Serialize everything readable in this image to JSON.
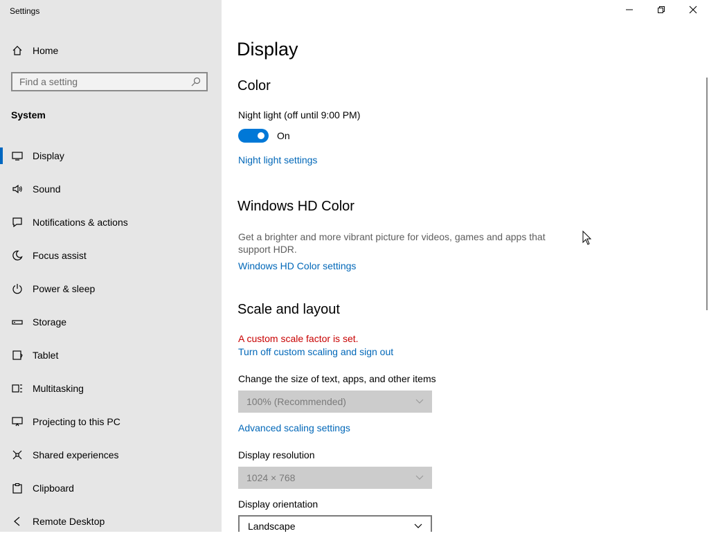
{
  "app": {
    "title": "Settings"
  },
  "window_controls": {
    "minimize": "minimize-icon",
    "restore": "restore-icon",
    "close": "close-icon"
  },
  "sidebar": {
    "home_label": "Home",
    "search_placeholder": "Find a setting",
    "section_label": "System",
    "items": [
      {
        "label": "Display",
        "icon": "monitor-icon",
        "selected": true
      },
      {
        "label": "Sound",
        "icon": "speaker-icon"
      },
      {
        "label": "Notifications & actions",
        "icon": "notification-icon"
      },
      {
        "label": "Focus assist",
        "icon": "moon-icon"
      },
      {
        "label": "Power & sleep",
        "icon": "power-icon"
      },
      {
        "label": "Storage",
        "icon": "storage-icon"
      },
      {
        "label": "Tablet",
        "icon": "tablet-icon"
      },
      {
        "label": "Multitasking",
        "icon": "multitasking-icon"
      },
      {
        "label": "Projecting to this PC",
        "icon": "projecting-icon"
      },
      {
        "label": "Shared experiences",
        "icon": "shared-experiences-icon"
      },
      {
        "label": "Clipboard",
        "icon": "clipboard-icon"
      },
      {
        "label": "Remote Desktop",
        "icon": "remote-desktop-icon"
      }
    ]
  },
  "main": {
    "page_title": "Display",
    "color": {
      "heading": "Color",
      "night_light_label": "Night light (off until 9:00 PM)",
      "toggle_state": "On",
      "night_light_link": "Night light settings"
    },
    "hd_color": {
      "heading": "Windows HD Color",
      "description": "Get a brighter and more vibrant picture for videos, games and apps that support HDR.",
      "link": "Windows HD Color settings"
    },
    "scale": {
      "heading": "Scale and layout",
      "warning": "A custom scale factor is set.",
      "turn_off_link": "Turn off custom scaling and sign out",
      "size_label": "Change the size of text, apps, and other items",
      "size_value": "100% (Recommended)",
      "advanced_link": "Advanced scaling settings",
      "resolution_label": "Display resolution",
      "resolution_value": "1024 × 768",
      "orientation_label": "Display orientation",
      "orientation_value": "Landscape"
    }
  },
  "colors": {
    "accent": "#0078d7",
    "link": "#0067b8",
    "error": "#c80000",
    "sidebar_bg": "#e6e6e6"
  }
}
